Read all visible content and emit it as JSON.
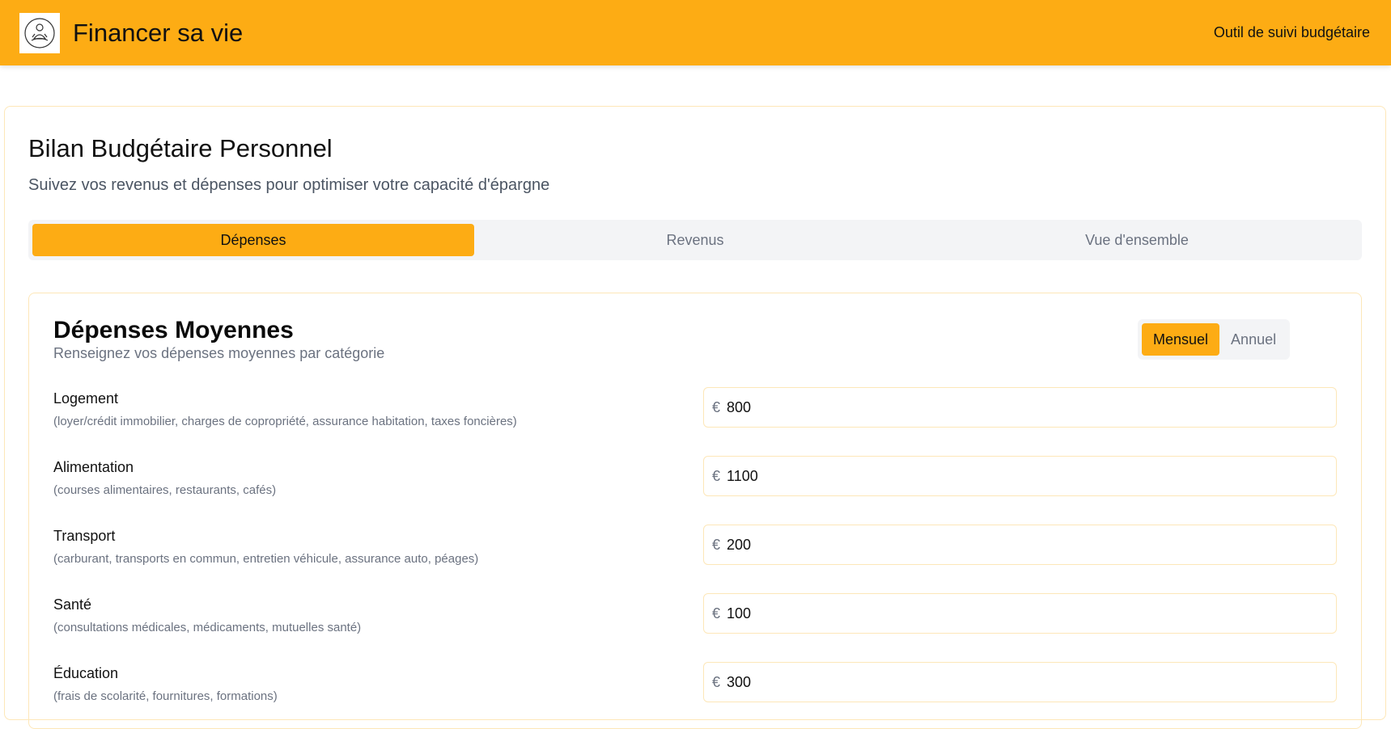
{
  "header": {
    "app_title": "Financer sa vie",
    "right_text": "Outil de suivi budgétaire",
    "accent_color": "#fdac14"
  },
  "page": {
    "title": "Bilan Budgétaire Personnel",
    "subtitle": "Suivez vos revenus et dépenses pour optimiser votre capacité d'épargne"
  },
  "tabs": [
    {
      "label": "Dépenses",
      "active": true
    },
    {
      "label": "Revenus",
      "active": false
    },
    {
      "label": "Vue d'ensemble",
      "active": false
    }
  ],
  "expenses": {
    "title": "Dépenses Moyennes",
    "subtitle": "Renseignez vos dépenses moyennes par catégorie",
    "period": {
      "options": [
        "Mensuel",
        "Annuel"
      ],
      "selected": "Mensuel"
    },
    "currency_symbol": "€",
    "categories": [
      {
        "label": "Logement",
        "description": "(loyer/crédit immobilier, charges de copropriété, assurance habitation, taxes foncières)",
        "value": "800"
      },
      {
        "label": "Alimentation",
        "description": "(courses alimentaires, restaurants, cafés)",
        "value": "1100"
      },
      {
        "label": "Transport",
        "description": "(carburant, transports en commun, entretien véhicule, assurance auto, péages)",
        "value": "200"
      },
      {
        "label": "Santé",
        "description": "(consultations médicales, médicaments, mutuelles santé)",
        "value": "100"
      },
      {
        "label": "Éducation",
        "description": "(frais de scolarité, fournitures, formations)",
        "value": "300"
      }
    ]
  }
}
